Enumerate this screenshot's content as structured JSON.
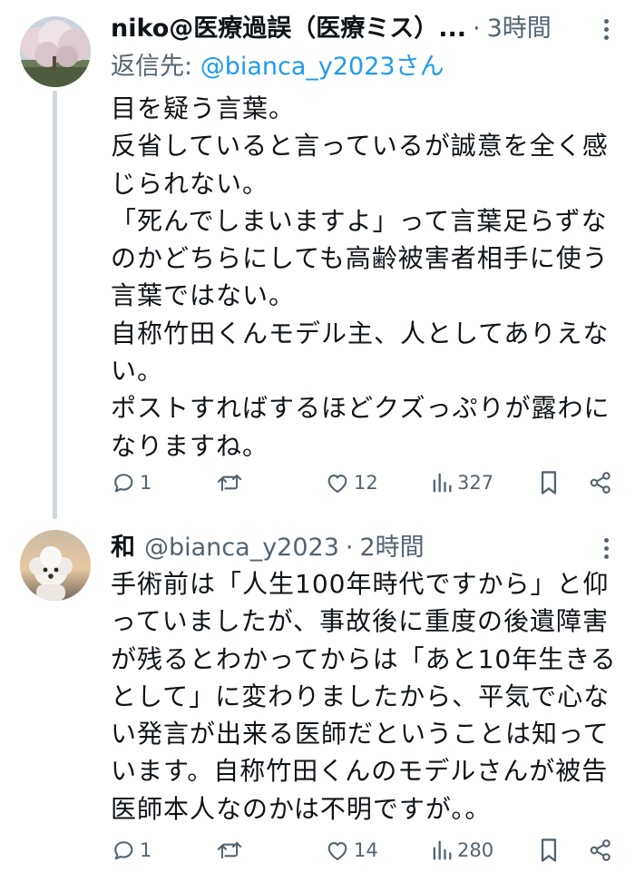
{
  "tweets": [
    {
      "author_name": "niko@医療過誤（医療ミス）...",
      "separator": "·",
      "time": "3時間",
      "reply_prefix": "返信先: ",
      "reply_to": "@bianca_y2023さん",
      "lines": [
        "目を疑う言葉。",
        "反省していると言っているが誠意を全く感",
        "じられない。",
        "「死んでしまいますよ」って言葉足らずな",
        "のかどちらにしても高齢被害者相手に使う",
        "言葉ではない。",
        "自称竹田くんモデル主、人としてありえな",
        "い。",
        "ポストすればするほどクズっぷりが露わに",
        "なりますね。"
      ],
      "replies": "1",
      "likes": "12",
      "views": "327",
      "avatar": "cherry-blossom-tree-photo"
    },
    {
      "author_name": "和",
      "handle": "@bianca_y2023",
      "separator": "·",
      "time": "2時間",
      "lines": [
        "手術前は「人生100年時代ですから」と仰",
        "っていましたが、事故後に重度の後遺障害",
        "が残るとわかってからは「あと10年生きる",
        "として」に変わりましたから、平気で心な",
        "い発言が出来る医師だということは知って",
        "います。自称竹田くんのモデルさんが被告",
        "医師本人なのかは不明ですが。。"
      ],
      "replies": "1",
      "likes": "14",
      "views": "280",
      "avatar": "white-poodle-photo"
    }
  ],
  "icons": {
    "reply": "comment-bubble-icon",
    "retweet": "repost-arrows-icon",
    "like": "heart-icon",
    "views": "bar-chart-icon",
    "bookmark": "bookmark-icon",
    "share": "share-icon",
    "more": "more-vertical-icon"
  },
  "colors": {
    "text": "#0f1419",
    "secondary": "#536471",
    "link": "#1d9bf0",
    "thread_line": "#cfd9de"
  }
}
